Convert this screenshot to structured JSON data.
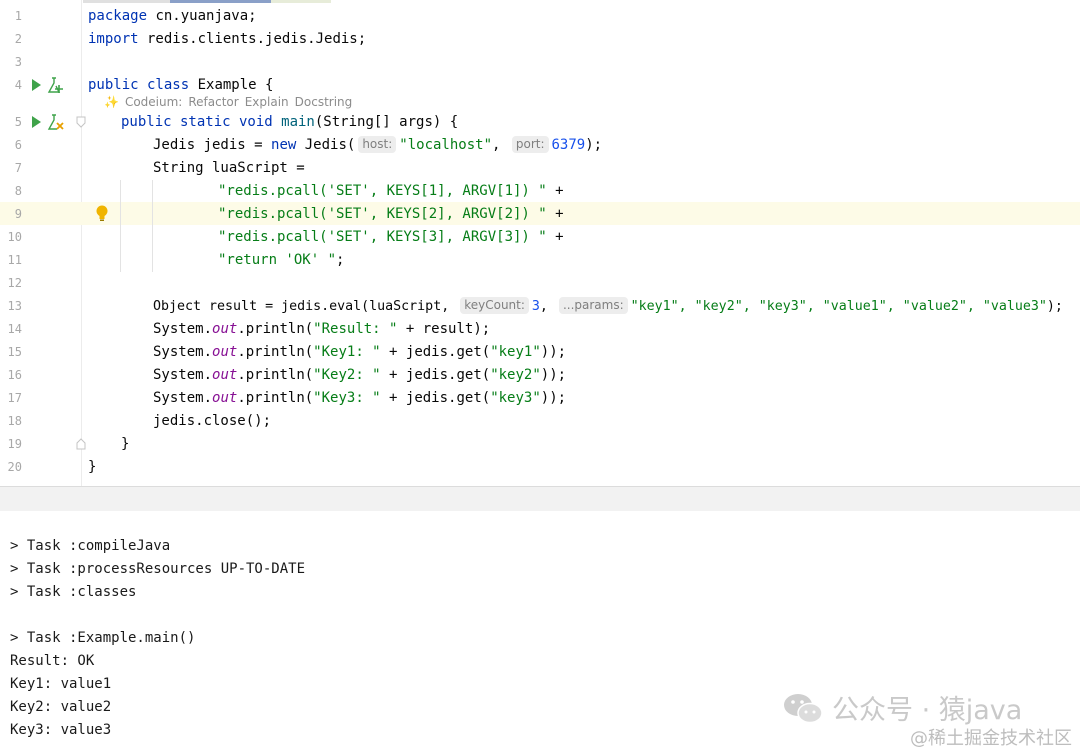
{
  "editor": {
    "line_numbers": [
      "1",
      "2",
      "3",
      "4",
      "5",
      "6",
      "7",
      "8",
      "9",
      "10",
      "11",
      "12",
      "13",
      "14",
      "15",
      "16",
      "17",
      "18",
      "19",
      "20"
    ],
    "lines": [
      {
        "kw": "package",
        "rest": " cn.yuanjava;"
      },
      {
        "kw": "import",
        "rest": " redis.clients.jedis.Jedis;"
      },
      {},
      {
        "kw": "public class",
        "rest": " Example {"
      },
      {
        "kw": "public static void",
        "fn": " main",
        "rest": "(String[] args) {"
      },
      {
        "a": "Jedis jedis = ",
        "kw": "new",
        "b": " Jedis(",
        "hint1": "host:",
        "s1": "\"localhost\"",
        ",": ", ",
        "hint2": "port:",
        "n": "6379",
        "end": ");"
      },
      {
        "a": "String luaScript ="
      },
      {
        "s": "\"redis.pcall('SET', KEYS[1], ARGV[1]) \"",
        "rest": " +"
      },
      {
        "s": "\"redis.pcall('SET', KEYS[2], ARGV[2]) \"",
        "rest": " +"
      },
      {
        "s": "\"redis.pcall('SET', KEYS[3], ARGV[3]) \"",
        "rest": " +"
      },
      {
        "s": "\"return 'OK' \"",
        "rest": ";"
      },
      {},
      {
        "a": "Object result = jedis.eval(luaScript, ",
        "hint1": "keyCount:",
        "n": "3",
        ",": ", ",
        "hint2": "...params:",
        "s": "\"key1\", \"key2\", \"key3\", \"value1\", \"value2\", \"value3\"",
        "end": ");"
      },
      {
        "a": "System.",
        "f": "out",
        "b": ".println(",
        "s": "\"Result: \"",
        "end": " + result);"
      },
      {
        "a": "System.",
        "f": "out",
        "b": ".println(",
        "s": "\"Key1: \"",
        "c": " + jedis.get(",
        "s2": "\"key1\"",
        "end": "));"
      },
      {
        "a": "System.",
        "f": "out",
        "b": ".println(",
        "s": "\"Key2: \"",
        "c": " + jedis.get(",
        "s2": "\"key2\"",
        "end": "));"
      },
      {
        "a": "System.",
        "f": "out",
        "b": ".println(",
        "s": "\"Key3: \"",
        "c": " + jedis.get(",
        "s2": "\"key3\"",
        "end": "));"
      },
      {
        "a": "jedis.close();"
      },
      {
        "a": "}"
      },
      {
        "a": "}"
      }
    ],
    "codelens": {
      "prefix": "Codeium:",
      "items": [
        "Refactor",
        "Explain",
        "Docstring"
      ]
    }
  },
  "console": {
    "lines": [
      "> Task :compileJava",
      "> Task :processResources UP-TO-DATE",
      "> Task :classes",
      "",
      "> Task :Example.main()",
      "Result: OK",
      "Key1: value1",
      "Key2: value2",
      "Key3: value3"
    ]
  },
  "watermark": {
    "main": "公众号 · 猿java",
    "sub": "@稀土掘金技术社区"
  },
  "colors": {
    "run": "#3fa34a",
    "bulb": "#f0b400",
    "highlight_line": "#fdfbe7"
  }
}
